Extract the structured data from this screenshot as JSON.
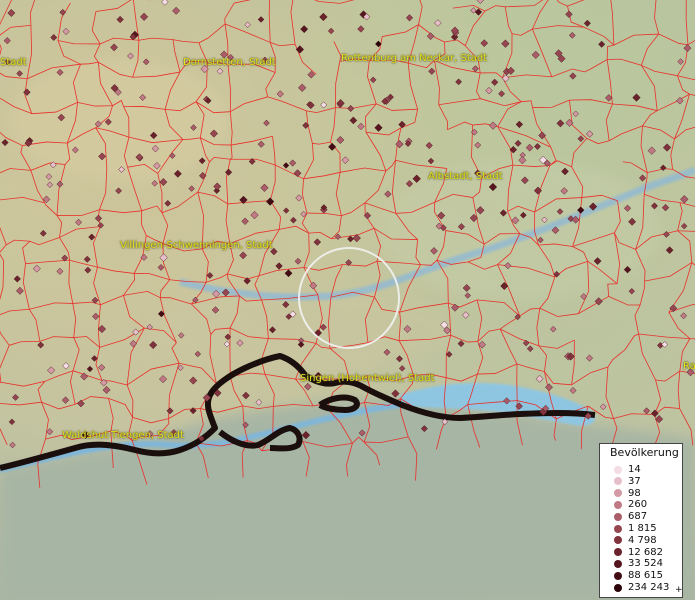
{
  "map": {
    "places": [
      {
        "label": "Stadt"
      },
      {
        "label": "Dornstetten, Stadt"
      },
      {
        "label": "Rottenburg am Neckar, Stadt"
      },
      {
        "label": "Albstadt, Stadt"
      },
      {
        "label": "Villingen-Schwenningen, Stadt"
      },
      {
        "label": "Singen (Hohentwiel), Stadt"
      },
      {
        "label": "Waldshut-Tiengen, Stadt"
      },
      {
        "label": "Ra"
      }
    ]
  },
  "legend": {
    "title": "Bevölkerung",
    "items": [
      {
        "value": "14",
        "color": "#f3dce4"
      },
      {
        "value": "37",
        "color": "#e7bfca"
      },
      {
        "value": "98",
        "color": "#d49aa6"
      },
      {
        "value": "260",
        "color": "#c07a86"
      },
      {
        "value": "687",
        "color": "#ab5d6a"
      },
      {
        "value": "1 815",
        "color": "#964651"
      },
      {
        "value": "4 798",
        "color": "#80333d"
      },
      {
        "value": "12 682",
        "color": "#6b232b"
      },
      {
        "value": "33 524",
        "color": "#561620"
      },
      {
        "value": "88 615",
        "color": "#410c14"
      },
      {
        "value": "234 243",
        "color": "#2c050a"
      }
    ],
    "plus": "+"
  }
}
